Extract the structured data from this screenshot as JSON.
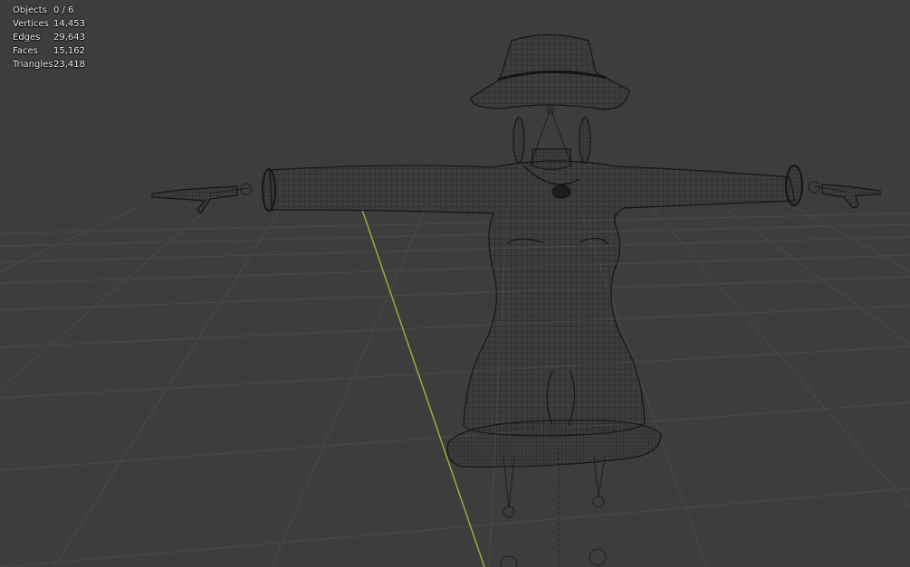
{
  "overlay_stats": [
    {
      "label": "Objects",
      "value": "0 / 6"
    },
    {
      "label": "Vertices",
      "value": "14,453"
    },
    {
      "label": "Edges",
      "value": "29,643"
    },
    {
      "label": "Faces",
      "value": "15,162"
    },
    {
      "label": "Triangles",
      "value": "23,418"
    }
  ],
  "colors": {
    "background": "#3d3d3d",
    "grid": "#4a4a4a",
    "y_axis": "#8fbc3a",
    "wire": "#161616",
    "stat_text": "#e6e6e6"
  }
}
